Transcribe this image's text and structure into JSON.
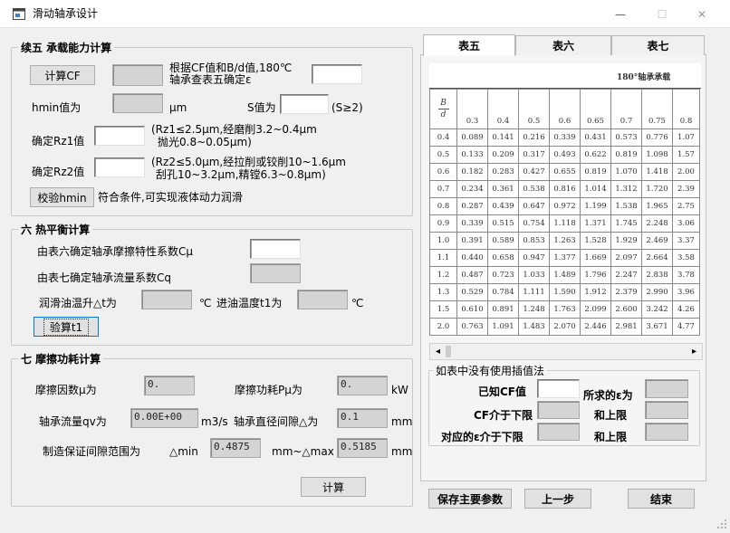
{
  "window": {
    "title": "滑动轴承设计",
    "minimize": "—",
    "maximize": "☐",
    "close": "✕"
  },
  "section5": {
    "title": "续五 承载能力计算",
    "calc_cf_button": "计算CF",
    "cf_note_line1": "根据CF值和B/d值,180℃",
    "cf_note_line2": "轴承查表五确定ε",
    "hmin_label": "hmin值为",
    "hmin_unit": "μm",
    "s_label": "S值为",
    "s_cond": "(S≥2)",
    "rz1_label": "确定Rz1值",
    "rz1_note_line1": "(Rz1≤2.5μm,经磨削3.2~0.4μm",
    "rz1_note_line2": "抛光0.8~0.05μm)",
    "rz2_label": "确定Rz2值",
    "rz2_note_line1": "(Rz2≤5.0μm,经拉削或铰削10~1.6μm",
    "rz2_note_line2": "刮孔10~3.2μm,精镗6.3~0.8μm)",
    "verify_button": "校验hmin",
    "verify_result": "符合条件,可实现液体动力润滑"
  },
  "section6": {
    "title": "六 热平衡计算",
    "cmu_label": "由表六确定轴承摩擦特性系数Cμ",
    "cq_label": "由表七确定轴承流量系数Cq",
    "dt_label": "润滑油温升△t为",
    "dt_unit": "℃",
    "t1_label": "进油温度t1为",
    "t1_unit": "℃",
    "verify_t1_button": "验算t1"
  },
  "section7": {
    "title": "七 摩擦功耗计算",
    "mu_label": "摩擦因数μ为",
    "mu_value": "0.",
    "pmu_label": "摩擦功耗Pμ为",
    "pmu_value": "0.",
    "pmu_unit": "kW",
    "qv_label": "轴承流量qv为",
    "qv_value": "0.00E+00",
    "qv_unit": "m3/s",
    "delta_label": "轴承直径间隙△为",
    "delta_value": "0.1",
    "delta_unit": "mm",
    "range_label": "制造保证间隙范围为",
    "dmin_label": "△min",
    "dmin_value": "0.4875",
    "range_mid": "mm~△max",
    "dmax_value": "0.5185",
    "range_unit": "mm",
    "calc_button": "计算"
  },
  "tabs": [
    {
      "label": "表五"
    },
    {
      "label": "表六"
    },
    {
      "label": "表七"
    }
  ],
  "table5": {
    "caption": "180°轴承承载",
    "corner_top": "B",
    "corner_bottom": "d",
    "columns": [
      "0.3",
      "0.4",
      "0.5",
      "0.6",
      "0.65",
      "0.7",
      "0.75",
      "0.8"
    ],
    "rows": [
      {
        "bd": "0.4",
        "v": [
          "0.089",
          "0.141",
          "0.216",
          "0.339",
          "0.431",
          "0.573",
          "0.776",
          "1.07"
        ]
      },
      {
        "bd": "0.5",
        "v": [
          "0.133",
          "0.209",
          "0.317",
          "0.493",
          "0.622",
          "0.819",
          "1.098",
          "1.57"
        ]
      },
      {
        "bd": "0.6",
        "v": [
          "0.182",
          "0.283",
          "0.427",
          "0.655",
          "0.819",
          "1.070",
          "1.418",
          "2.00"
        ]
      },
      {
        "bd": "0.7",
        "v": [
          "0.234",
          "0.361",
          "0.538",
          "0.816",
          "1.014",
          "1.312",
          "1.720",
          "2.39"
        ]
      },
      {
        "bd": "0.8",
        "v": [
          "0.287",
          "0.439",
          "0.647",
          "0.972",
          "1.199",
          "1.538",
          "1.965",
          "2.75"
        ]
      },
      {
        "bd": "0.9",
        "v": [
          "0.339",
          "0.515",
          "0.754",
          "1.118",
          "1.371",
          "1.745",
          "2.248",
          "3.06"
        ]
      },
      {
        "bd": "1.0",
        "v": [
          "0.391",
          "0.589",
          "0.853",
          "1.263",
          "1.528",
          "1.929",
          "2.469",
          "3.37"
        ]
      },
      {
        "bd": "1.1",
        "v": [
          "0.440",
          "0.658",
          "0.947",
          "1.377",
          "1.669",
          "2.097",
          "2.664",
          "3.58"
        ]
      },
      {
        "bd": "1.2",
        "v": [
          "0.487",
          "0.723",
          "1.033",
          "1.489",
          "1.796",
          "2.247",
          "2.838",
          "3.78"
        ]
      },
      {
        "bd": "1.3",
        "v": [
          "0.529",
          "0.784",
          "1.111",
          "1.590",
          "1.912",
          "2.379",
          "2.990",
          "3.96"
        ]
      },
      {
        "bd": "1.5",
        "v": [
          "0.610",
          "0.891",
          "1.248",
          "1.763",
          "2.099",
          "2.600",
          "3.242",
          "4.26"
        ]
      },
      {
        "bd": "2.0",
        "v": [
          "0.763",
          "1.091",
          "1.483",
          "2.070",
          "2.446",
          "2.981",
          "3.671",
          "4.77"
        ]
      }
    ]
  },
  "interp": {
    "title": "如表中没有使用插值法",
    "known_cf": "已知CF值",
    "found_eps": "所求的ε为",
    "cf_between": "CF介于下限",
    "upper1": "和上限",
    "eps_between": "对应的ε介于下限",
    "upper2": "和上限"
  },
  "footer": {
    "save_button": "保存主要参数",
    "prev_button": "上一步",
    "end_button": "结束"
  },
  "scroll": {
    "left": "◂",
    "right": "▸"
  }
}
